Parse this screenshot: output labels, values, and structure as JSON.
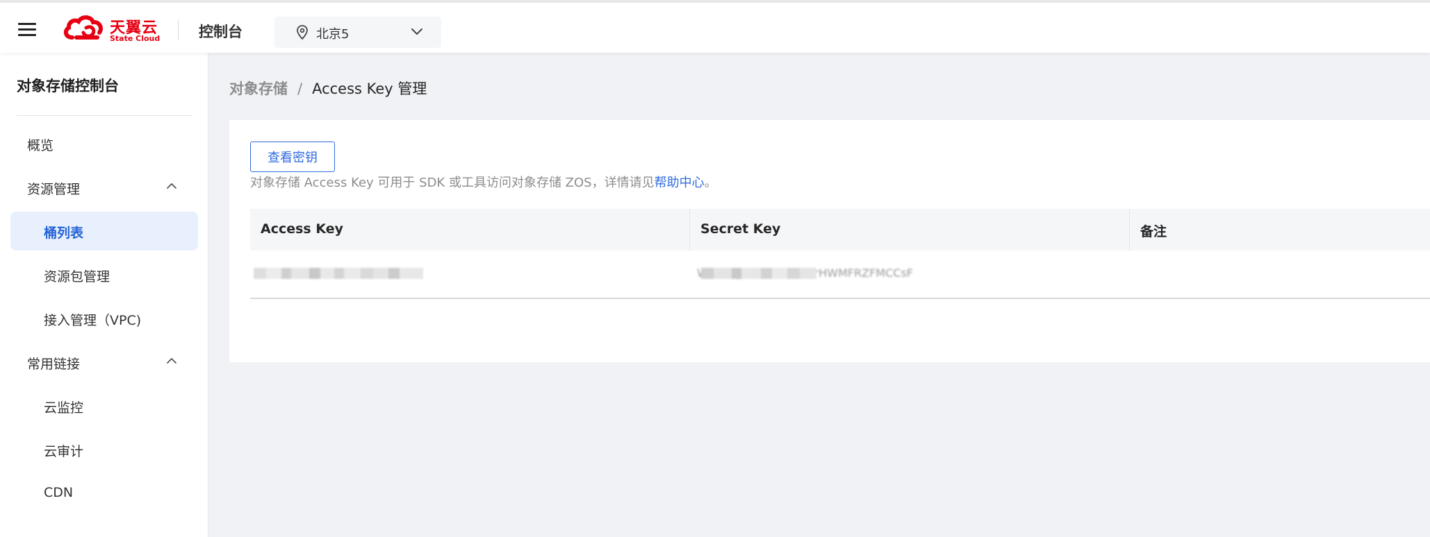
{
  "header": {
    "logo": {
      "text_cn": "天翼云",
      "text_en": "State Cloud",
      "brand_color": "#e60012"
    },
    "console_title": "控制台",
    "region": "北京5"
  },
  "sidebar": {
    "title": "对象存储控制台",
    "items": [
      {
        "label": "概览"
      },
      {
        "label": "资源管理"
      },
      {
        "label": "桶列表"
      },
      {
        "label": "资源包管理"
      },
      {
        "label": "接入管理（VPC)"
      },
      {
        "label": "常用链接"
      },
      {
        "label": "云监控"
      },
      {
        "label": "云审计"
      },
      {
        "label": "CDN"
      }
    ]
  },
  "breadcrumb": {
    "parent": "对象存储",
    "separator": "/",
    "current": "Access Key 管理"
  },
  "main": {
    "view_key_button": "查看密钥",
    "description_prefix": "对象存储 Access Key 可用于 SDK 或工具访问对象存储 ZOS，详情请见",
    "help_link": "帮助中心",
    "description_suffix": "。",
    "table": {
      "columns": [
        "Access Key",
        "Secret Key",
        "备注"
      ],
      "rows": [
        {
          "secret_key_visible_fragment": "W......QyRrLZRs WPfcrHWMFRZFMCCsF"
        }
      ]
    }
  },
  "colors": {
    "accent": "#2f6bdf",
    "active_nav_bg": "#e9f0fd",
    "page_bg": "#f0f2f5"
  }
}
